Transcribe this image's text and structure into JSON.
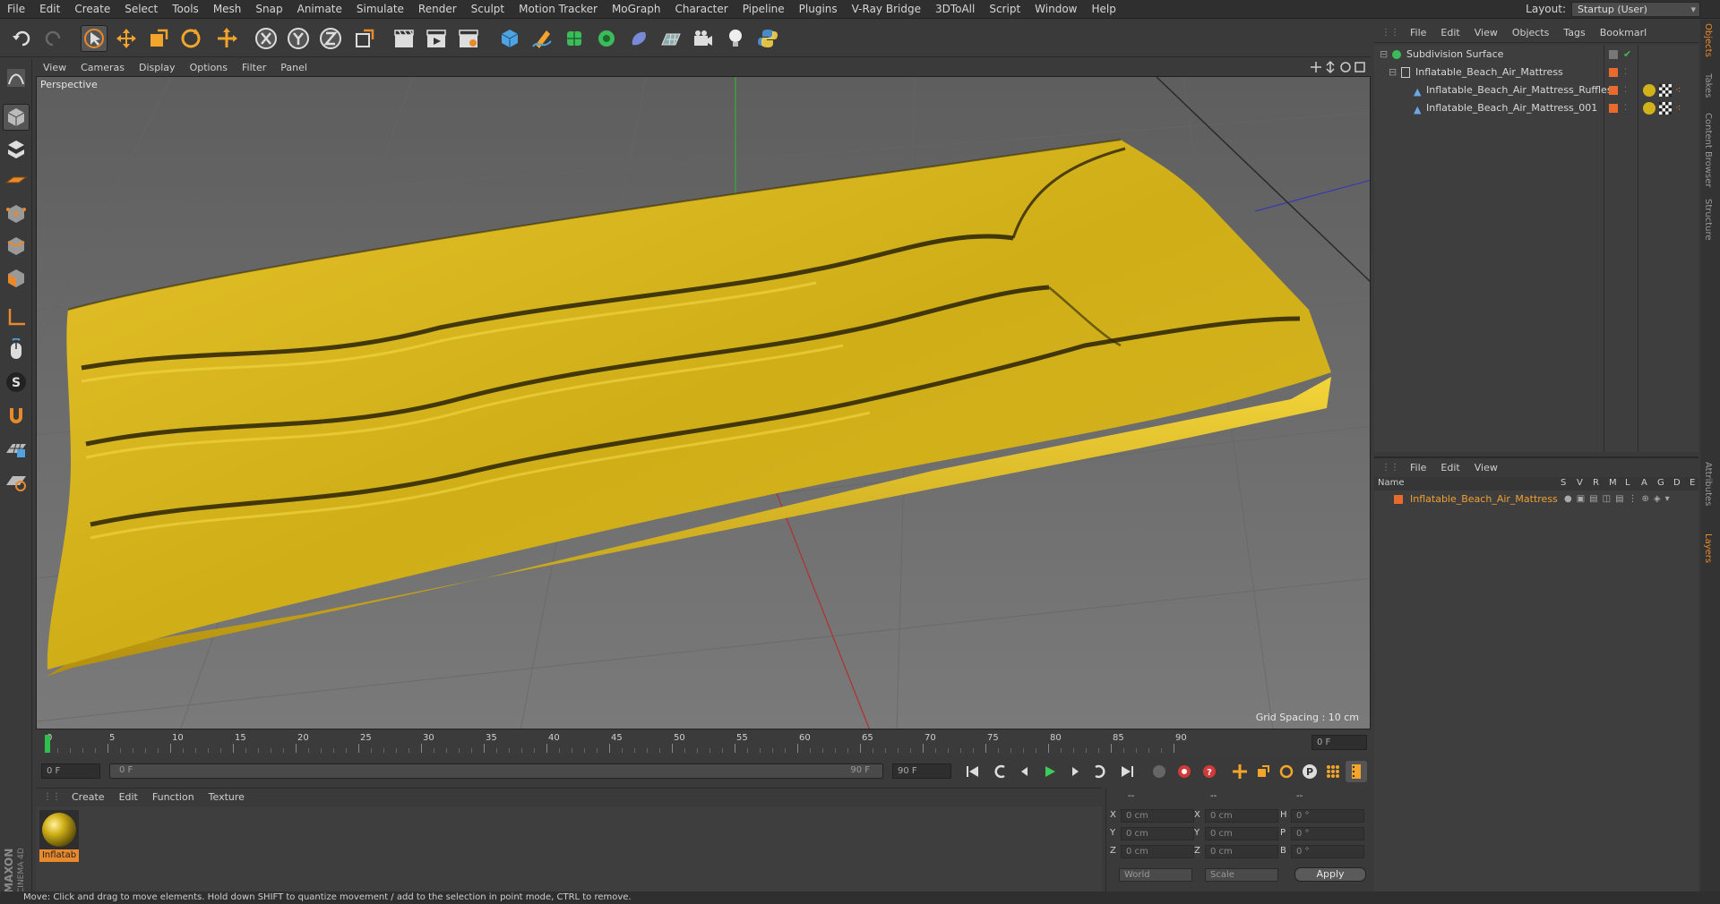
{
  "menubar": {
    "items": [
      "File",
      "Edit",
      "Create",
      "Select",
      "Tools",
      "Mesh",
      "Snap",
      "Animate",
      "Simulate",
      "Render",
      "Sculpt",
      "Motion Tracker",
      "MoGraph",
      "Character",
      "Pipeline",
      "Plugins",
      "V-Ray Bridge",
      "3DToAll",
      "Script",
      "Window",
      "Help"
    ],
    "layout_label": "Layout:",
    "layout_value": "Startup (User)"
  },
  "viewport": {
    "menu": [
      "View",
      "Cameras",
      "Display",
      "Options",
      "Filter",
      "Panel"
    ],
    "camera_label": "Perspective",
    "grid_spacing": "Grid Spacing : 10 cm"
  },
  "timeline": {
    "ticks": [
      "0",
      "5",
      "10",
      "15",
      "20",
      "25",
      "30",
      "35",
      "40",
      "45",
      "50",
      "55",
      "60",
      "65",
      "70",
      "75",
      "80",
      "85",
      "90"
    ],
    "current_frame_field": "0 F"
  },
  "transport": {
    "start_field": "0 F",
    "range_start": "0 F",
    "range_end": "90 F",
    "end_field": "90 F"
  },
  "material_manager": {
    "menu": [
      "Create",
      "Edit",
      "Function",
      "Texture"
    ],
    "material_label": "Inflatab"
  },
  "coordinates": {
    "header_dashes": [
      "--",
      "--",
      "--"
    ],
    "rows": [
      {
        "a": "X",
        "av": "0 cm",
        "b": "X",
        "bv": "0 cm",
        "c": "H",
        "cv": "0 °"
      },
      {
        "a": "Y",
        "av": "0 cm",
        "b": "Y",
        "bv": "0 cm",
        "c": "P",
        "cv": "0 °"
      },
      {
        "a": "Z",
        "av": "0 cm",
        "b": "Z",
        "bv": "0 cm",
        "c": "B",
        "cv": "0 °"
      }
    ],
    "world_select": "World",
    "scale_select": "Scale",
    "apply_label": "Apply"
  },
  "object_manager": {
    "menu": [
      "File",
      "Edit",
      "View",
      "Objects",
      "Tags",
      "Bookmarl"
    ],
    "objects": [
      {
        "name": "Subdivision Surface"
      },
      {
        "name": "Inflatable_Beach_Air_Mattress"
      },
      {
        "name": "Inflatable_Beach_Air_Mattress_Ruffles"
      },
      {
        "name": "Inflatable_Beach_Air_Mattress_001"
      }
    ]
  },
  "layer_manager": {
    "menu": [
      "File",
      "Edit",
      "View"
    ],
    "columns": [
      "Name",
      "S",
      "V",
      "R",
      "M",
      "L",
      "A",
      "G",
      "D",
      "E"
    ],
    "layers": [
      {
        "name": "Inflatable_Beach_Air_Mattress"
      }
    ]
  },
  "side_tabs": [
    "Objects",
    "Takes",
    "Content Browser",
    "Structure",
    "Attributes",
    "Layers"
  ],
  "maxon_text": [
    "MAXON",
    "CINEMA 4D"
  ],
  "status": "Move: Click and drag to move elements. Hold down SHIFT to quantize movement / add to the selection in point mode, CTRL to remove.",
  "colors": {
    "accent_orange": "#e8892c",
    "mattress_yellow": "#d8b41c",
    "layer_text": "#f0a030"
  }
}
